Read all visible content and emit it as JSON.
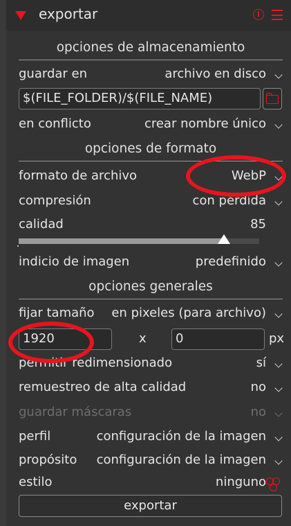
{
  "module": {
    "title": "exportar"
  },
  "storage": {
    "section_title": "opciones de almacenamiento",
    "save_in_label": "guardar en",
    "save_in_value": "archivo en disco",
    "path_value": "$(FILE_FOLDER)/$(FILE_NAME)",
    "on_conflict_label": "en conflicto",
    "on_conflict_value": "crear nombre único"
  },
  "format": {
    "section_title": "opciones de formato",
    "file_format_label": "formato de archivo",
    "file_format_value": "WebP",
    "compression_label": "compresión",
    "compression_value": "con pérdida",
    "quality_label": "calidad",
    "quality_value": "85",
    "image_hint_label": "indicio de imagen",
    "image_hint_value": "predefinido"
  },
  "general": {
    "section_title": "opciones generales",
    "set_size_label": "fijar tamaño",
    "set_size_value": "en pixeles (para archivo)",
    "width_value": "1920",
    "x_label": "x",
    "height_value": "0",
    "unit_label": "px",
    "allow_upscale_label": "permitir redimensionado",
    "allow_upscale_value": "sí",
    "hq_resample_label": "remuestreo de alta calidad",
    "hq_resample_value": "no",
    "store_masks_label": "guardar máscaras",
    "store_masks_value": "no",
    "profile_label": "perfil",
    "profile_value": "configuración de la imagen",
    "intent_label": "propósito",
    "intent_value": "configuración de la imagen",
    "style_label": "estilo",
    "style_value": "ninguno"
  },
  "actions": {
    "export_label": "exportar"
  },
  "colors": {
    "accent": "#e8141e",
    "panel": "#333333",
    "text": "#e6e6e6"
  }
}
